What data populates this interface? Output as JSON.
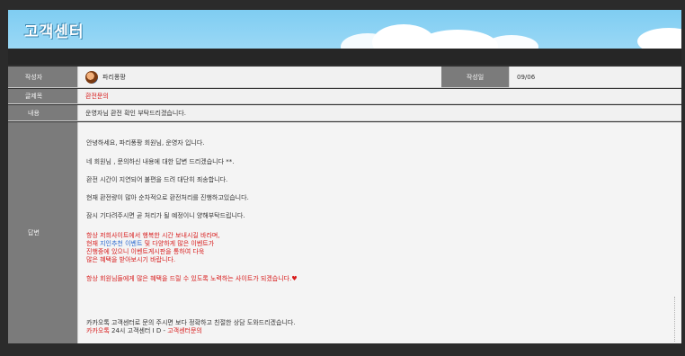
{
  "banner": {
    "title": "고객센터"
  },
  "rows": {
    "author": {
      "label": "작성자",
      "name": "파리퐁팡"
    },
    "date": {
      "label": "작성일",
      "value": "09/06"
    },
    "subject": {
      "label": "글제목",
      "value": "환전문의"
    },
    "content": {
      "label": "내용",
      "value": "운영자님 환전 확인 부탁드리겠습니다."
    },
    "answer": {
      "label": "답변"
    }
  },
  "answer": {
    "greeting": "안녕하세요, 파리퐁팡 회원님, 운영자 입니다.",
    "reply_intro": "네 회원님 , 문의하신 내용에 대한 답변 드리겠습니다 **.",
    "p1": "환전 시간이 지연되어 불편을 드려 대단히 죄송합니다.",
    "p2": "현재 환전량이 많아 순차적으로 환전처리를 진행하고있습니다.",
    "p3": "잠시 기다려주시면 곧 처리가 될 예정이니 양해부탁드립니다.",
    "promo1": "항상 저희사이트에서 행복한 시간 보내시길 바라며,",
    "promo2_a": "현재 ",
    "promo2_b": "지인추천 이벤트",
    "promo2_c": " 및 다양하게 많은 이벤트가",
    "promo3": "진행중에 있으니 이벤트게시판을 통하여 다욱",
    "promo4": "많은 혜택을 받아보시기 바랍니다.",
    "promo5": "항상 회원님들에게 많은 혜택을 드릴 수 있도록 노력하는 사이트가 되겠습니다.♥",
    "kakao1": "카카오톡 고객센터로 문의 주시면 보다 정확하고 친절한 상담 도와드리겠습니다.",
    "kakao2_a": "카카오톡",
    "kakao2_b": " 24시 고객센터 I D - ",
    "kakao2_c": "고객센터문의"
  }
}
